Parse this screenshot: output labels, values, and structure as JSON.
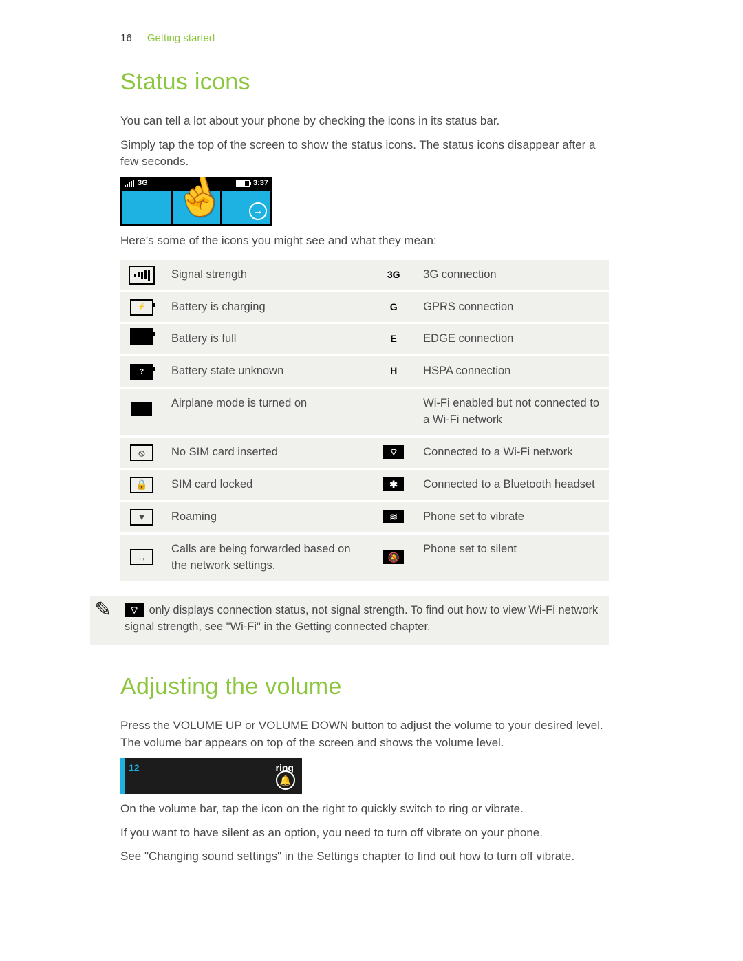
{
  "header": {
    "page_number": "16",
    "section": "Getting started"
  },
  "status_icons": {
    "title": "Status icons",
    "intro1": "You can tell a lot about your phone by checking the icons in its status bar.",
    "intro2": "Simply tap the top of the screen to show the status icons. The status icons disappear after a few seconds.",
    "after_image": "Here's some of the icons you might see and what they mean:",
    "statusbar": {
      "net_label": "3G",
      "time": "3:37"
    },
    "table_left": [
      {
        "glyph": "signal",
        "text": "Signal strength"
      },
      {
        "glyph": "charging",
        "text": "Battery is charging"
      },
      {
        "glyph": "battfull",
        "text": "Battery is full"
      },
      {
        "glyph": "battunknown",
        "text": "Battery state unknown"
      },
      {
        "glyph": "airplane",
        "text": "Airplane mode is turned on"
      },
      {
        "glyph": "nosim",
        "text": "No SIM card inserted"
      },
      {
        "glyph": "simlock",
        "text": "SIM card locked"
      },
      {
        "glyph": "roaming",
        "text": "Roaming"
      },
      {
        "glyph": "callfwd",
        "text": "Calls are being forwarded based on the network settings."
      }
    ],
    "table_right": [
      {
        "glyph": "3G",
        "text": "3G connection"
      },
      {
        "glyph": "G",
        "text": "GPRS connection"
      },
      {
        "glyph": "E",
        "text": "EDGE connection"
      },
      {
        "glyph": "H",
        "text": "HSPA connection"
      },
      {
        "glyph": "",
        "text": "Wi-Fi enabled but not connected to a Wi-Fi network"
      },
      {
        "glyph": "wifi",
        "text": "Connected to a Wi-Fi network"
      },
      {
        "glyph": "bt",
        "text": "Connected to a Bluetooth headset"
      },
      {
        "glyph": "vibrate",
        "text": "Phone set to vibrate"
      },
      {
        "glyph": "silent",
        "text": "Phone set to silent"
      }
    ],
    "note": " only displays connection status, not signal strength. To find out how to view Wi-Fi network signal strength, see \"Wi-Fi\" in the Getting connected chapter."
  },
  "volume": {
    "title": "Adjusting the volume",
    "intro": "Press the VOLUME UP or VOLUME DOWN button to adjust the volume to your desired level. The volume bar appears on top of the screen and shows the volume level.",
    "bar_value": "12",
    "bar_label": "ring",
    "after1": "On the volume bar, tap the icon on the right to quickly switch to ring or vibrate.",
    "after2": "If you want to have silent as an option, you need to turn off vibrate on your phone.",
    "after3": "See \"Changing sound settings\" in the Settings chapter to find out how to turn off vibrate."
  }
}
